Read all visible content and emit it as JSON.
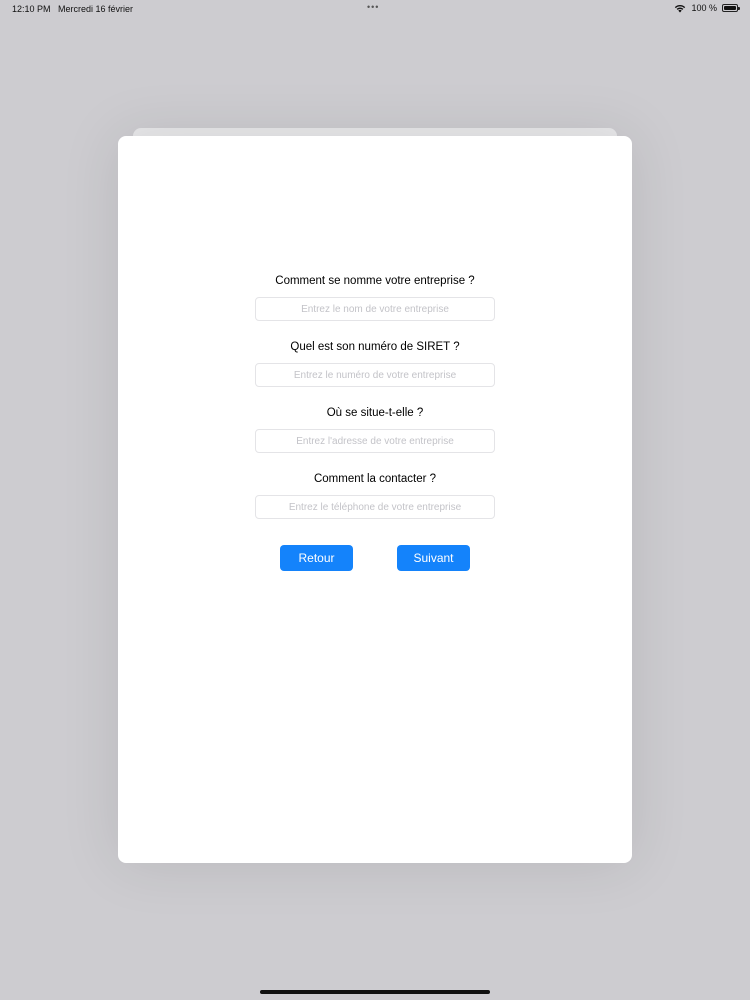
{
  "status_bar": {
    "time": "12:10 PM",
    "date": "Mercredi 16 février",
    "dots": "•••",
    "battery_text": "100 %"
  },
  "form": {
    "questions": [
      {
        "label": "Comment se nomme votre entreprise ?",
        "placeholder": "Entrez le nom de votre entreprise"
      },
      {
        "label": "Quel est son numéro de SIRET ?",
        "placeholder": "Entrez le numéro de votre entreprise"
      },
      {
        "label": "Où se situe-t-elle ?",
        "placeholder": "Entrez l'adresse de votre entreprise"
      },
      {
        "label": "Comment la contacter ?",
        "placeholder": "Entrez le téléphone de votre entreprise"
      }
    ],
    "back_label": "Retour",
    "next_label": "Suivant"
  },
  "colors": {
    "background": "#cdccd0",
    "sheet": "#ffffff",
    "accent": "#1483fb"
  },
  "icons": [
    "wifi-icon",
    "battery-icon"
  ]
}
